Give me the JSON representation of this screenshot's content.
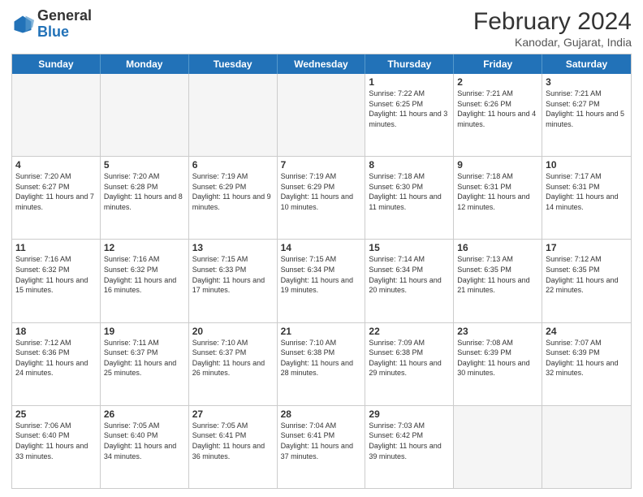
{
  "header": {
    "logo_line1": "General",
    "logo_line2": "Blue",
    "title": "February 2024",
    "subtitle": "Kanodar, Gujarat, India"
  },
  "calendar": {
    "days_of_week": [
      "Sunday",
      "Monday",
      "Tuesday",
      "Wednesday",
      "Thursday",
      "Friday",
      "Saturday"
    ],
    "weeks": [
      [
        {
          "day": "",
          "info": "",
          "empty": true
        },
        {
          "day": "",
          "info": "",
          "empty": true
        },
        {
          "day": "",
          "info": "",
          "empty": true
        },
        {
          "day": "",
          "info": "",
          "empty": true
        },
        {
          "day": "1",
          "info": "Sunrise: 7:22 AM\nSunset: 6:25 PM\nDaylight: 11 hours\nand 3 minutes.",
          "empty": false
        },
        {
          "day": "2",
          "info": "Sunrise: 7:21 AM\nSunset: 6:26 PM\nDaylight: 11 hours\nand 4 minutes.",
          "empty": false
        },
        {
          "day": "3",
          "info": "Sunrise: 7:21 AM\nSunset: 6:27 PM\nDaylight: 11 hours\nand 5 minutes.",
          "empty": false
        }
      ],
      [
        {
          "day": "4",
          "info": "Sunrise: 7:20 AM\nSunset: 6:27 PM\nDaylight: 11 hours\nand 7 minutes.",
          "empty": false
        },
        {
          "day": "5",
          "info": "Sunrise: 7:20 AM\nSunset: 6:28 PM\nDaylight: 11 hours\nand 8 minutes.",
          "empty": false
        },
        {
          "day": "6",
          "info": "Sunrise: 7:19 AM\nSunset: 6:29 PM\nDaylight: 11 hours\nand 9 minutes.",
          "empty": false
        },
        {
          "day": "7",
          "info": "Sunrise: 7:19 AM\nSunset: 6:29 PM\nDaylight: 11 hours\nand 10 minutes.",
          "empty": false
        },
        {
          "day": "8",
          "info": "Sunrise: 7:18 AM\nSunset: 6:30 PM\nDaylight: 11 hours\nand 11 minutes.",
          "empty": false
        },
        {
          "day": "9",
          "info": "Sunrise: 7:18 AM\nSunset: 6:31 PM\nDaylight: 11 hours\nand 12 minutes.",
          "empty": false
        },
        {
          "day": "10",
          "info": "Sunrise: 7:17 AM\nSunset: 6:31 PM\nDaylight: 11 hours\nand 14 minutes.",
          "empty": false
        }
      ],
      [
        {
          "day": "11",
          "info": "Sunrise: 7:16 AM\nSunset: 6:32 PM\nDaylight: 11 hours\nand 15 minutes.",
          "empty": false
        },
        {
          "day": "12",
          "info": "Sunrise: 7:16 AM\nSunset: 6:32 PM\nDaylight: 11 hours\nand 16 minutes.",
          "empty": false
        },
        {
          "day": "13",
          "info": "Sunrise: 7:15 AM\nSunset: 6:33 PM\nDaylight: 11 hours\nand 17 minutes.",
          "empty": false
        },
        {
          "day": "14",
          "info": "Sunrise: 7:15 AM\nSunset: 6:34 PM\nDaylight: 11 hours\nand 19 minutes.",
          "empty": false
        },
        {
          "day": "15",
          "info": "Sunrise: 7:14 AM\nSunset: 6:34 PM\nDaylight: 11 hours\nand 20 minutes.",
          "empty": false
        },
        {
          "day": "16",
          "info": "Sunrise: 7:13 AM\nSunset: 6:35 PM\nDaylight: 11 hours\nand 21 minutes.",
          "empty": false
        },
        {
          "day": "17",
          "info": "Sunrise: 7:12 AM\nSunset: 6:35 PM\nDaylight: 11 hours\nand 22 minutes.",
          "empty": false
        }
      ],
      [
        {
          "day": "18",
          "info": "Sunrise: 7:12 AM\nSunset: 6:36 PM\nDaylight: 11 hours\nand 24 minutes.",
          "empty": false
        },
        {
          "day": "19",
          "info": "Sunrise: 7:11 AM\nSunset: 6:37 PM\nDaylight: 11 hours\nand 25 minutes.",
          "empty": false
        },
        {
          "day": "20",
          "info": "Sunrise: 7:10 AM\nSunset: 6:37 PM\nDaylight: 11 hours\nand 26 minutes.",
          "empty": false
        },
        {
          "day": "21",
          "info": "Sunrise: 7:10 AM\nSunset: 6:38 PM\nDaylight: 11 hours\nand 28 minutes.",
          "empty": false
        },
        {
          "day": "22",
          "info": "Sunrise: 7:09 AM\nSunset: 6:38 PM\nDaylight: 11 hours\nand 29 minutes.",
          "empty": false
        },
        {
          "day": "23",
          "info": "Sunrise: 7:08 AM\nSunset: 6:39 PM\nDaylight: 11 hours\nand 30 minutes.",
          "empty": false
        },
        {
          "day": "24",
          "info": "Sunrise: 7:07 AM\nSunset: 6:39 PM\nDaylight: 11 hours\nand 32 minutes.",
          "empty": false
        }
      ],
      [
        {
          "day": "25",
          "info": "Sunrise: 7:06 AM\nSunset: 6:40 PM\nDaylight: 11 hours\nand 33 minutes.",
          "empty": false
        },
        {
          "day": "26",
          "info": "Sunrise: 7:05 AM\nSunset: 6:40 PM\nDaylight: 11 hours\nand 34 minutes.",
          "empty": false
        },
        {
          "day": "27",
          "info": "Sunrise: 7:05 AM\nSunset: 6:41 PM\nDaylight: 11 hours\nand 36 minutes.",
          "empty": false
        },
        {
          "day": "28",
          "info": "Sunrise: 7:04 AM\nSunset: 6:41 PM\nDaylight: 11 hours\nand 37 minutes.",
          "empty": false
        },
        {
          "day": "29",
          "info": "Sunrise: 7:03 AM\nSunset: 6:42 PM\nDaylight: 11 hours\nand 39 minutes.",
          "empty": false
        },
        {
          "day": "",
          "info": "",
          "empty": true
        },
        {
          "day": "",
          "info": "",
          "empty": true
        }
      ]
    ]
  }
}
